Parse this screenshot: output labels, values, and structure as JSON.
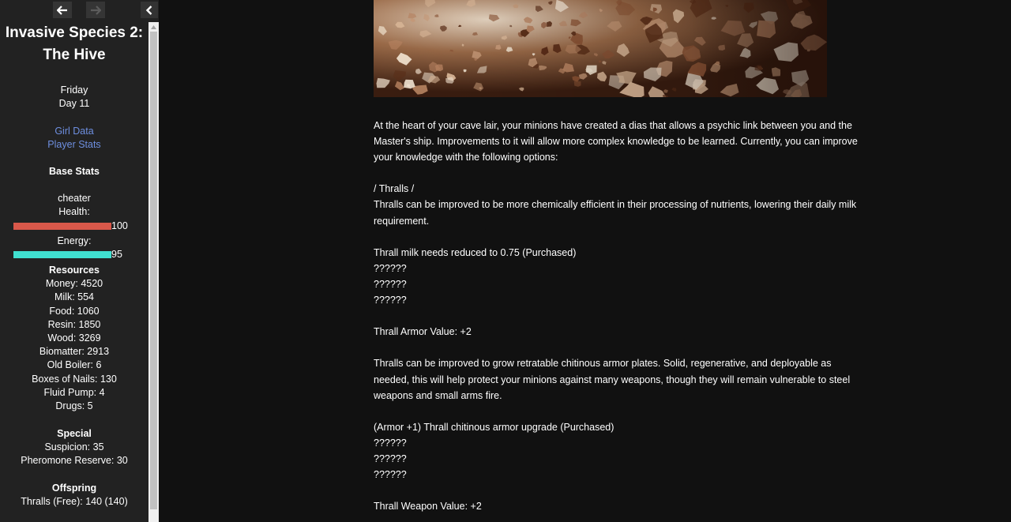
{
  "sidebar": {
    "title": "Invasive Species 2: The Hive",
    "day_name": "Friday",
    "day_number": "Day 11",
    "links": [
      "Girl Data",
      "Player Stats"
    ],
    "base_stats": {
      "heading": "Base Stats",
      "player_name": "cheater",
      "health_label": "Health:",
      "health_value": "100",
      "health_percent": 100,
      "health_color": "#d9584a",
      "energy_label": "Energy:",
      "energy_value": "95",
      "energy_percent": 100,
      "energy_color": "#40e0d0"
    },
    "resources": {
      "heading": "Resources",
      "items": [
        "Money: 4520",
        "Milk: 554",
        "Food: 1060",
        "Resin: 1850",
        "Wood: 3269",
        "Biomatter: 2913",
        "Old Boiler: 6",
        "Boxes of Nails: 130",
        "Fluid Pump: 4",
        "Drugs: 5"
      ]
    },
    "special": {
      "heading": "Special",
      "items": [
        "Suspicion: 35",
        "Pheromone Reserve: 30"
      ]
    },
    "offspring": {
      "heading": "Offspring",
      "items": [
        "Thralls (Free): 140 (140)"
      ]
    },
    "icons": {
      "back": "arrow-left-icon",
      "forward": "arrow-right-icon",
      "toggle": "chevron-left-icon"
    }
  },
  "passage": {
    "intro": "At the heart of your cave lair, your minions have created a dias that allows a psychic link between you and the Master's ship. Improvements to it will allow more complex knowledge to be learned. Currently, you can improve your knowledge with the following options:",
    "section_header": "/ Thralls /",
    "milk_description": "Thralls can be improved to be more chemically efficient in their processing of nutrients, lowering their daily milk requirement.",
    "milk_upgrades": [
      "Thrall milk needs reduced to 0.75 (Purchased)",
      "??????",
      "??????",
      "??????"
    ],
    "armor_value": "Thrall Armor Value: +2",
    "armor_description": "Thralls can be improved to grow retratable chitinous armor plates. Solid, regenerative, and deployable as needed, this will help protect your minions against many weapons, though they will remain vulnerable to steel weapons and small arms fire.",
    "armor_upgrades": [
      "(Armor +1) Thrall chitinous armor upgrade (Purchased)",
      "??????",
      "??????",
      "??????"
    ],
    "weapon_value": "Thrall Weapon Value: +2"
  }
}
